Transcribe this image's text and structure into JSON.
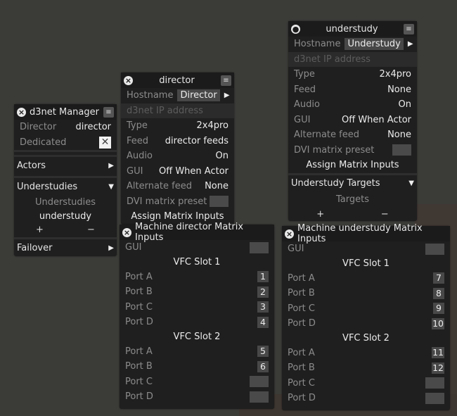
{
  "manager": {
    "title": "d3net Manager",
    "director_label": "Director",
    "director_value": "director",
    "dedicated_label": "Dedicated",
    "dedicated_checked": true,
    "actors_label": "Actors",
    "understudies_label": "Understudies",
    "understudies_list_header": "Understudies",
    "understudies": [
      "understudy"
    ],
    "add": "+",
    "remove": "−",
    "failover_label": "Failover"
  },
  "director": {
    "title": "director",
    "hostname_label": "Hostname",
    "hostname": "Director",
    "ip_placeholder": "d3net IP address",
    "fields": [
      {
        "label": "Type",
        "value": "2x4pro"
      },
      {
        "label": "Feed",
        "value": "director feeds"
      },
      {
        "label": "Audio",
        "value": "On"
      },
      {
        "label": "GUI",
        "value": "Off When Actor"
      },
      {
        "label": "Alternate feed",
        "value": "None"
      }
    ],
    "dvi_label": "DVI matrix preset",
    "assign_label": "Assign Matrix Inputs"
  },
  "understudy": {
    "title": "understudy",
    "hostname_label": "Hostname",
    "hostname": "Understudy",
    "ip_placeholder": "d3net IP address",
    "fields": [
      {
        "label": "Type",
        "value": "2x4pro"
      },
      {
        "label": "Feed",
        "value": "None"
      },
      {
        "label": "Audio",
        "value": "On"
      },
      {
        "label": "GUI",
        "value": "Off When Actor"
      },
      {
        "label": "Alternate feed",
        "value": "None"
      }
    ],
    "dvi_label": "DVI matrix preset",
    "assign_label": "Assign Matrix Inputs",
    "targets_section": "Understudy Targets",
    "targets_header": "Targets",
    "add": "+",
    "remove": "−"
  },
  "director_matrix": {
    "title": "Machine director Matrix Inputs",
    "gui_label": "GUI",
    "slots": [
      {
        "label": "VFC Slot 1",
        "ports": [
          {
            "label": "Port A",
            "value": "1"
          },
          {
            "label": "Port B",
            "value": "2"
          },
          {
            "label": "Port C",
            "value": "3"
          },
          {
            "label": "Port D",
            "value": "4"
          }
        ]
      },
      {
        "label": "VFC Slot 2",
        "ports": [
          {
            "label": "Port A",
            "value": "5"
          },
          {
            "label": "Port B",
            "value": "6"
          },
          {
            "label": "Port C",
            "value": ""
          },
          {
            "label": "Port D",
            "value": ""
          }
        ]
      }
    ]
  },
  "understudy_matrix": {
    "title": "Machine understudy Matrix Inputs",
    "gui_label": "GUI",
    "slots": [
      {
        "label": "VFC Slot 1",
        "ports": [
          {
            "label": "Port A",
            "value": "7"
          },
          {
            "label": "Port B",
            "value": "8"
          },
          {
            "label": "Port C",
            "value": "9"
          },
          {
            "label": "Port D",
            "value": "10"
          }
        ]
      },
      {
        "label": "VFC Slot 2",
        "ports": [
          {
            "label": "Port A",
            "value": "11"
          },
          {
            "label": "Port B",
            "value": "12"
          },
          {
            "label": "Port C",
            "value": ""
          },
          {
            "label": "Port D",
            "value": ""
          }
        ]
      }
    ]
  },
  "icons": {
    "close": "close-circle-icon",
    "pin": "pin-icon",
    "note": "note-edit-icon"
  }
}
